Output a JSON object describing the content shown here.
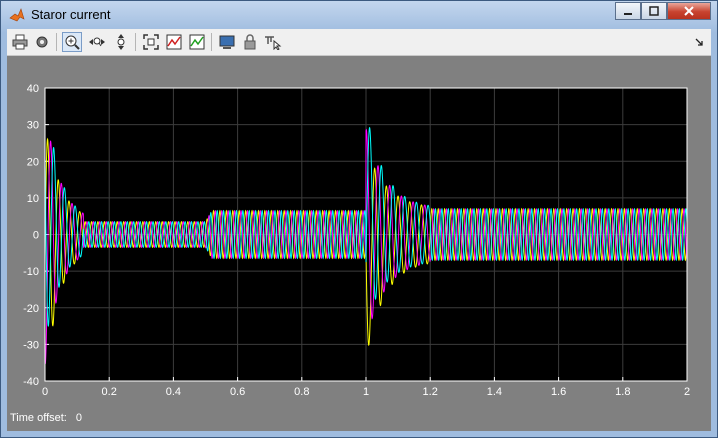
{
  "window": {
    "title": "Staror  current"
  },
  "toolbar": {
    "buttons": [
      {
        "icon": "print-icon"
      },
      {
        "icon": "settings-gear-icon"
      },
      {
        "icon": "zoom-in-icon"
      },
      {
        "icon": "zoom-x-icon"
      },
      {
        "icon": "zoom-y-icon"
      },
      {
        "icon": "autoscale-icon"
      },
      {
        "icon": "save-axes-settings-icon"
      },
      {
        "icon": "restore-axes-settings-icon"
      },
      {
        "icon": "floating-scope-icon"
      },
      {
        "icon": "lock-axes-icon"
      },
      {
        "icon": "signal-selection-icon"
      }
    ]
  },
  "status": {
    "label": "Time offset:",
    "value": "0"
  },
  "colors": {
    "axes_bg": "#000000",
    "figure_bg": "#808080",
    "grid": "#3c3c3c",
    "phase_a": "#ffff00",
    "phase_b": "#ff00ff",
    "phase_c": "#00ffff"
  },
  "chart_data": {
    "type": "line",
    "title": "",
    "xlabel": "",
    "ylabel": "",
    "xlim": [
      0,
      2
    ],
    "ylim": [
      -40,
      40
    ],
    "xticks": [
      "0",
      "0.2",
      "0.4",
      "0.6",
      "0.8",
      "1",
      "1.2",
      "1.4",
      "1.6",
      "1.8",
      "2"
    ],
    "yticks": [
      "40",
      "30",
      "20",
      "10",
      "0",
      "-10",
      "-20",
      "-30",
      "-40"
    ],
    "grid": true,
    "frequency_hz": 50,
    "series": [
      {
        "color": "#ffff00",
        "phase_deg": 0
      },
      {
        "color": "#ff00ff",
        "phase_deg": -120
      },
      {
        "color": "#00ffff",
        "phase_deg": 120
      }
    ],
    "segments": [
      {
        "t_start": 0.0,
        "t_end": 0.12,
        "description": "startup transient",
        "peak": 36
      },
      {
        "t_start": 0.12,
        "t_end": 0.5,
        "amplitude": 3.5
      },
      {
        "t_start": 0.5,
        "t_end": 1.0,
        "amplitude": 6.5
      },
      {
        "t_start": 1.0,
        "t_end": 1.2,
        "description": "transient",
        "peak": 29
      },
      {
        "t_start": 1.2,
        "t_end": 2.0,
        "amplitude": 7
      }
    ]
  }
}
